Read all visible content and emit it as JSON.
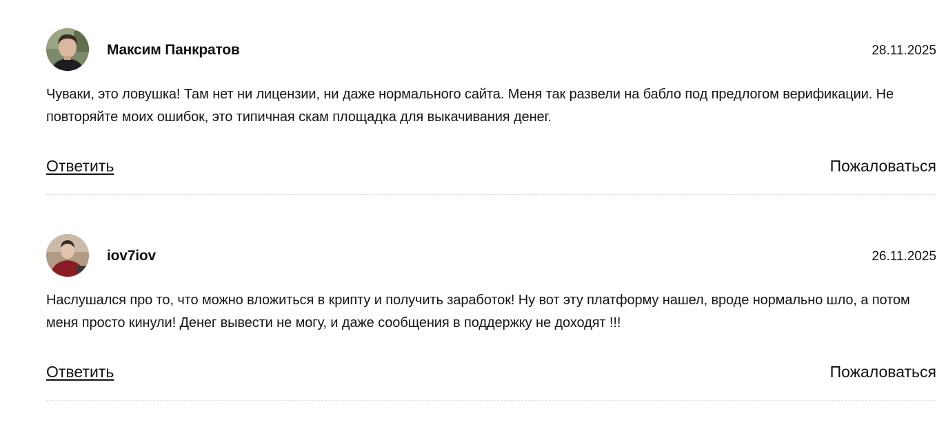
{
  "comments": [
    {
      "author": "Максим Панкратов",
      "date": "28.11.2025",
      "text": "Чуваки, это ловушка! Там нет ни лицензии, ни даже нормального сайта. Меня так развели на бабло под предлогом верификации. Не повторяйте моих ошибок, это типичная скам площадка для выкачивания денег.",
      "reply_label": "Ответить",
      "report_label": "Пожаловаться",
      "avatar_icon": "user-photo-avatar"
    },
    {
      "author": "iov7iov",
      "date": "26.11.2025",
      "text": "Наслушался про то, что можно вложиться в крипту и получить заработок! Ну вот эту платформу нашел, вроде нормально шло, а потом меня просто кинули! Денег вывести не могу, и даже сообщения в поддержку не доходят !!!",
      "reply_label": "Ответить",
      "report_label": "Пожаловаться",
      "avatar_icon": "user-photo-avatar"
    }
  ],
  "colors": {
    "text": "#111111",
    "divider": "#dcdcdc",
    "background": "#ffffff"
  }
}
